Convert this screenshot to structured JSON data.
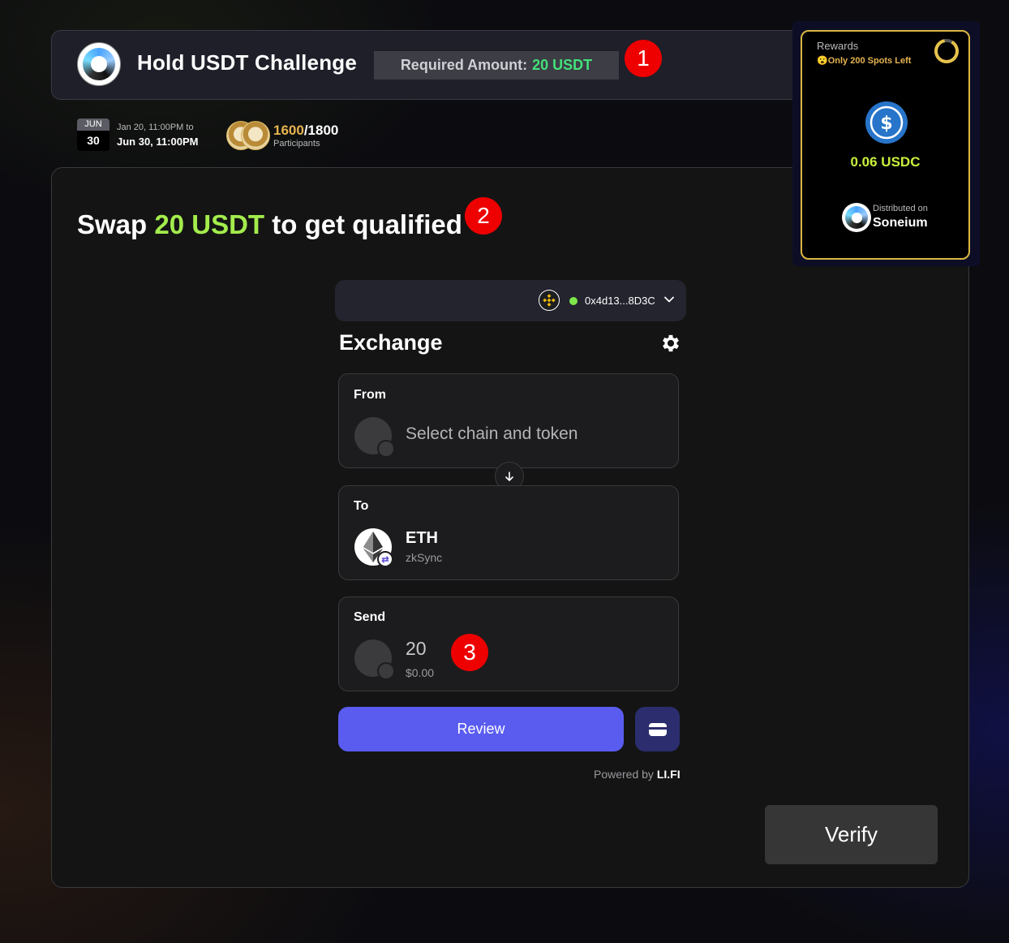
{
  "challenge": {
    "title": "Hold USDT Challenge",
    "required_label": "Required Amount:",
    "required_value": "20 USDT",
    "date": {
      "month": "JUN",
      "day": "30",
      "range_start": "Jan 20, 11:00PM to",
      "range_end": "Jun 30, 11:00PM"
    },
    "participants": {
      "current": "1600",
      "total": "/1800",
      "label": "Participants"
    }
  },
  "annotations": {
    "step1": "1",
    "step2": "2",
    "step3": "3"
  },
  "main": {
    "heading_prefix": "Swap",
    "heading_amount": "20 USDT",
    "heading_suffix": "to get qualified",
    "verify_label": "Verify"
  },
  "widget": {
    "wallet_address": "0x4d13...8D3C",
    "wallet_icon": "bnb-chain-icon",
    "title": "Exchange",
    "from": {
      "label": "From",
      "placeholder": "Select chain and token"
    },
    "to": {
      "label": "To",
      "token": "ETH",
      "chain": "zkSync"
    },
    "send": {
      "label": "Send",
      "amount": "20",
      "usd_value": "$0.00"
    },
    "review_label": "Review",
    "powered_by": "Powered by",
    "powered_brand": "LI.FI"
  },
  "rewards": {
    "label": "Rewards",
    "spots_left": "Only 200 Spots Left",
    "amount": "0.06 USDC",
    "distributed_label": "Distributed on",
    "network": "Soneium"
  },
  "colors": {
    "accent_green": "#43e07a",
    "heading_green": "#a3ec4c",
    "review_blue": "#5a5cf0",
    "gold": "#e6b450",
    "badge_red": "#ee0000"
  }
}
